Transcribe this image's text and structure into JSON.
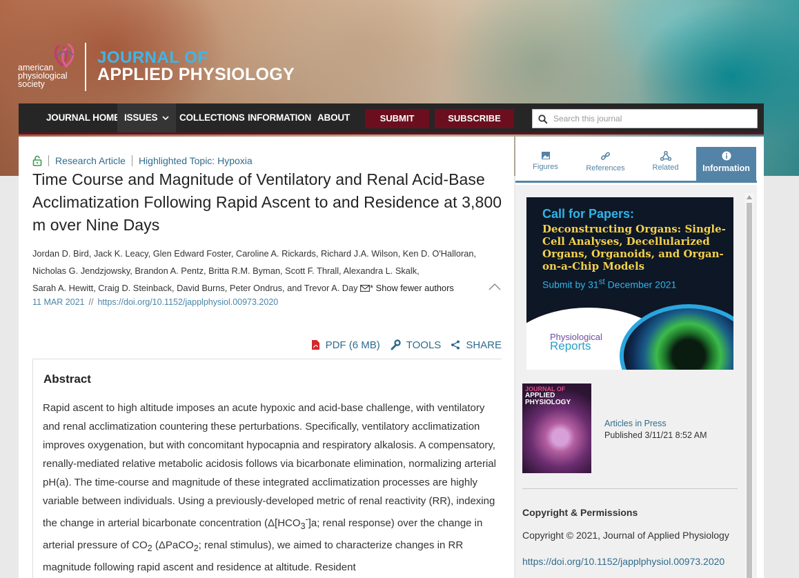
{
  "brand": {
    "society_lines": [
      "american",
      "physiological",
      "society"
    ],
    "journal_line1": "JOURNAL OF",
    "journal_line2": "APPLIED PHYSIOLOGY"
  },
  "nav": {
    "items": [
      "JOURNAL HOME",
      "ISSUES",
      "COLLECTIONS",
      "INFORMATION",
      "ABOUT"
    ],
    "submit": "SUBMIT",
    "subscribe": "SUBSCRIBE",
    "search_placeholder": "Search this journal"
  },
  "article": {
    "type": "Research Article",
    "topic": "Highlighted Topic: Hypoxia",
    "title": "Time Course and Magnitude of Ventilatory and Renal Acid-Base Acclimatization Following Rapid Ascent to and Residence at 3,800 m over Nine Days",
    "authors_line1": "Jordan D. Bird, Jack K. Leacy, Glen Edward Foster, Caroline A. Rickards, Richard J.A. Wilson, Ken D. O'Halloran,",
    "authors_line2": "Nicholas G. Jendzjowsky, Brandon A. Pentz, Britta R.M. Byman, Scott F. Thrall, Alexandra L. Skalk,",
    "authors_line3": "Sarah A. Hewitt, Craig D. Steinback, David Burns, Peter Ondrus, and Trevor A. Day",
    "corresponding_mark": "*",
    "show_fewer": "Show fewer authors",
    "date": "11 MAR 2021",
    "date_sep": "//",
    "doi": "https://doi.org/10.1152/japplphysiol.00973.2020",
    "tools": {
      "pdf": "PDF (6 MB)",
      "tools": "TOOLS",
      "share": "SHARE"
    }
  },
  "abstract": {
    "heading": "Abstract",
    "p1": "Rapid ascent to high altitude imposes an acute hypoxic and acid-base challenge, with ventilatory and renal acclimatization countering these perturbations. Specifically, ventilatory acclimatization improves oxygenation, but with concomitant hypocapnia and respiratory alkalosis. A compensatory, renally-mediated relative metabolic acidosis follows via bicarbonate elimination, normalizing arterial pH(a). The time-course and magnitude of these integrated acclimatization processes are highly variable between individuals. Using a previously-developed metric of renal reactivity (RR), indexing the change in arterial bicarbonate concentration (Δ[HCO",
    "sub3": "3",
    "sup_minus": "-",
    "p2": "]a; renal response) over the change in arterial pressure of CO",
    "sub2a": "2",
    "p3": " (ΔPaCO",
    "sub2b": "2",
    "p4": "; renal stimulus), we aimed to characterize changes in RR magnitude following rapid ascent and residence at altitude. Resident"
  },
  "sidebar": {
    "tabs": [
      "Figures",
      "References",
      "Related",
      "Information"
    ],
    "active_tab": "Information",
    "cfp": {
      "head": "Call for Papers:",
      "body": "Deconstructing Organs: Single-Cell Analyses, Decellularized Organs, Organoids, and Organ-on-a-Chip Models",
      "date_pre": "Submit by 31",
      "date_sup": "st",
      "date_post": " December 2021",
      "logo1": "Physiological",
      "logo2": "Reports"
    },
    "cover": {
      "line1": "JOURNAL OF",
      "line2": "APPLIED PHYSIOLOGY"
    },
    "articles_in_press": "Articles in Press",
    "published": "Published 3/11/21 8:52 AM",
    "copyright_heading": "Copyright & Permissions",
    "copyright_text": "Copyright © 2021, Journal of Applied Physiology",
    "copyright_doi": "https://doi.org/10.1152/japplphysiol.00973.2020"
  },
  "colors": {
    "nav_bg": "#262626",
    "accent_maroon": "#6b0f1e",
    "link_blue": "#2f6b8c",
    "tab_blue": "#5383a6",
    "brand_blue": "#3fb6e6"
  }
}
